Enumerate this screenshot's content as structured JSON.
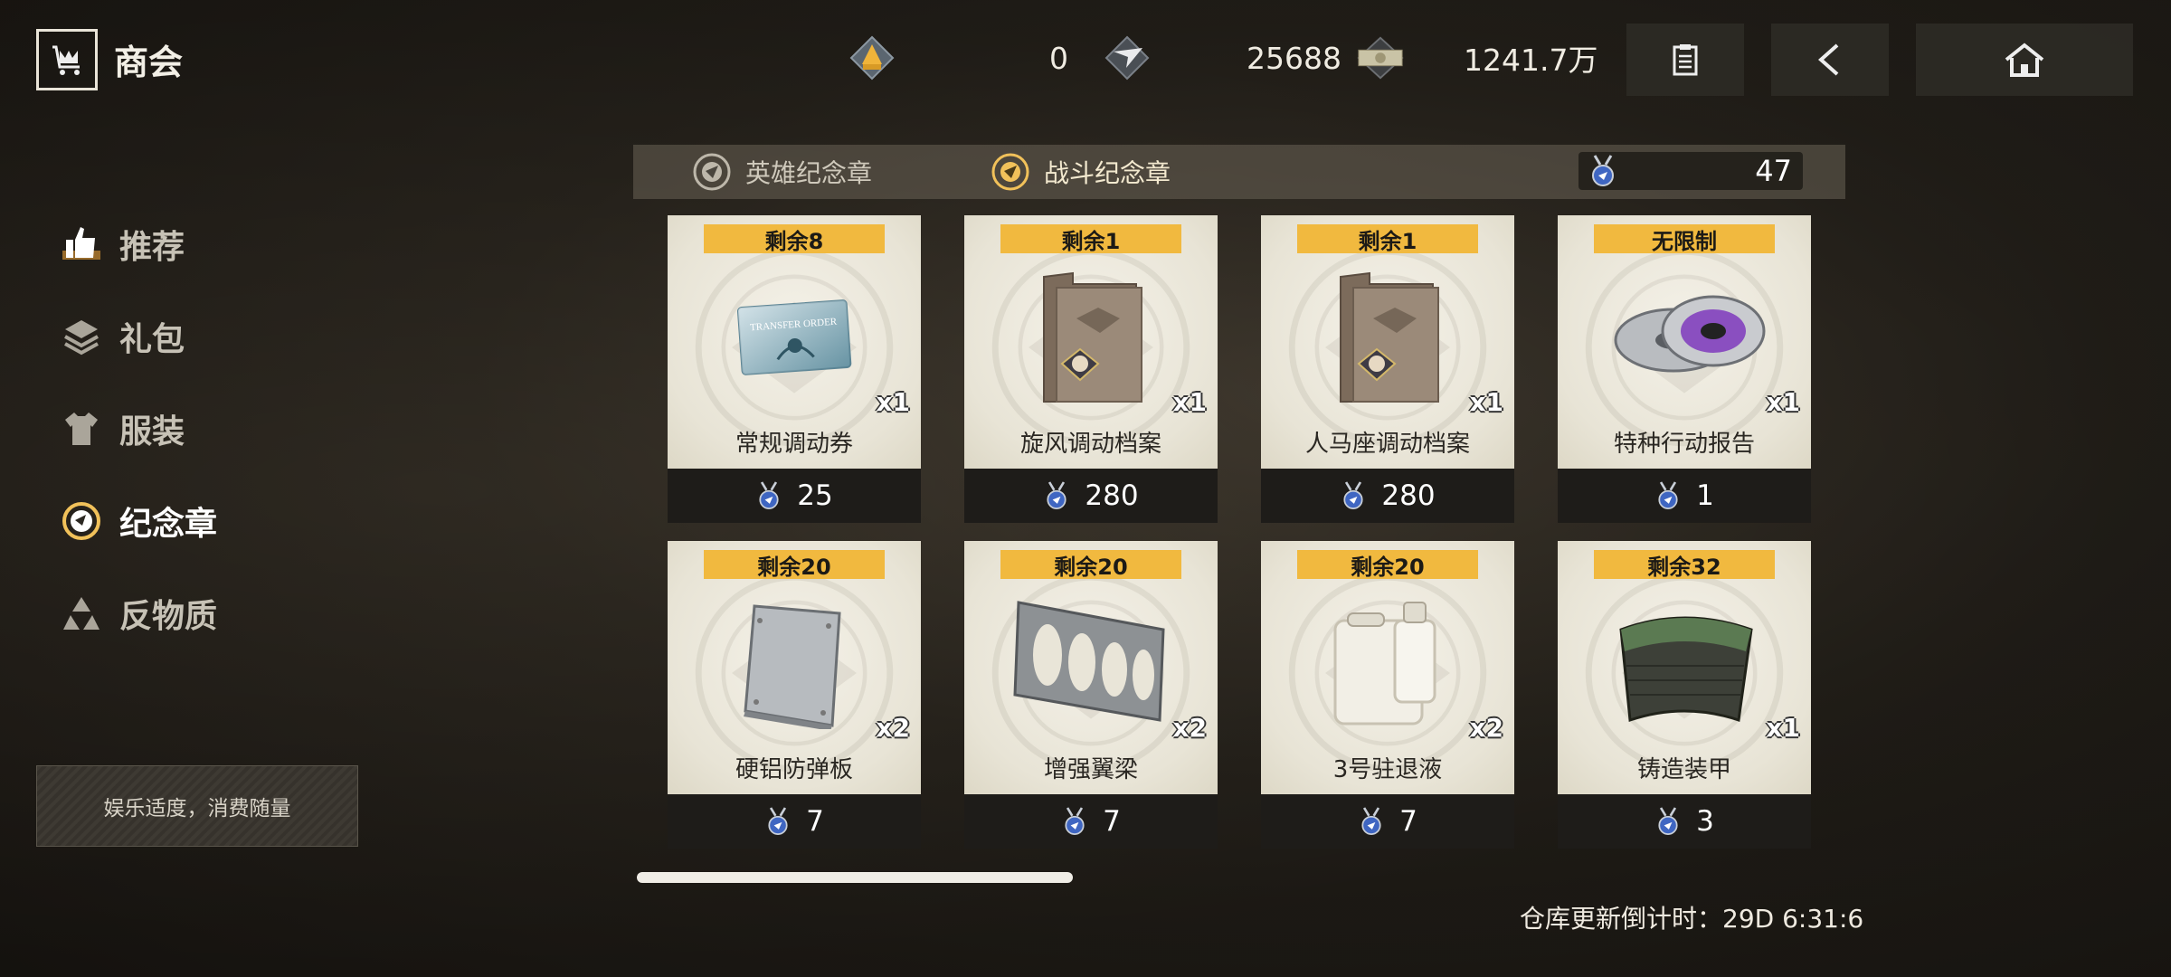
{
  "app": {
    "title": "商会"
  },
  "resources": [
    {
      "icon": "rank-badge-icon",
      "value": "0"
    },
    {
      "icon": "wing-badge-icon",
      "value": "25688"
    },
    {
      "icon": "cash-icon",
      "value": "1241.7万"
    }
  ],
  "top_buttons": [
    {
      "icon": "clipboard-icon"
    },
    {
      "icon": "back-arrow-icon"
    },
    {
      "icon": "home-icon"
    }
  ],
  "sidebar": {
    "items": [
      {
        "label": "推荐",
        "icon": "thumbs-up-icon",
        "active": false
      },
      {
        "label": "礼包",
        "icon": "layers-icon",
        "active": false
      },
      {
        "label": "服装",
        "icon": "tshirt-icon",
        "active": false
      },
      {
        "label": "纪念章",
        "icon": "medal-icon",
        "active": true
      },
      {
        "label": "反物质",
        "icon": "antimatter-icon",
        "active": false
      }
    ],
    "notice": "娱乐适度，消费随量"
  },
  "tabs": [
    {
      "label": "英雄纪念章",
      "icon": "hero-medal-icon",
      "active": false
    },
    {
      "label": "战斗纪念章",
      "icon": "battle-medal-icon",
      "active": true
    }
  ],
  "currency": {
    "icon": "medal-currency-icon",
    "value": "47"
  },
  "items": [
    {
      "stock": "剩余8",
      "name": "常规调动券",
      "qty": "x1",
      "price": "25",
      "art": "ticket",
      "art_text": "TRANSFER ORDER"
    },
    {
      "stock": "剩余1",
      "name": "旋风调动档案",
      "qty": "x1",
      "price": "280",
      "art": "folder"
    },
    {
      "stock": "剩余1",
      "name": "人马座调动档案",
      "qty": "x1",
      "price": "280",
      "art": "folder"
    },
    {
      "stock": "无限制",
      "name": "特种行动报告",
      "qty": "x1",
      "price": "1",
      "art": "disc"
    },
    {
      "stock": "剩余20",
      "name": "硬铝防弹板",
      "qty": "x2",
      "price": "7",
      "art": "plate"
    },
    {
      "stock": "剩余20",
      "name": "增强翼梁",
      "qty": "x2",
      "price": "7",
      "art": "spar"
    },
    {
      "stock": "剩余20",
      "name": "3号驻退液",
      "qty": "x2",
      "price": "7",
      "art": "jerrycan"
    },
    {
      "stock": "剩余32",
      "name": "铸造装甲",
      "qty": "x1",
      "price": "3",
      "art": "armor"
    }
  ],
  "scroll_progress": 0.36,
  "countdown": "仓库更新倒计时：29D 6:31:6",
  "colors": {
    "badge": "#f1b93f",
    "price_bar": "#1e1c19",
    "card": "#efebe0"
  }
}
